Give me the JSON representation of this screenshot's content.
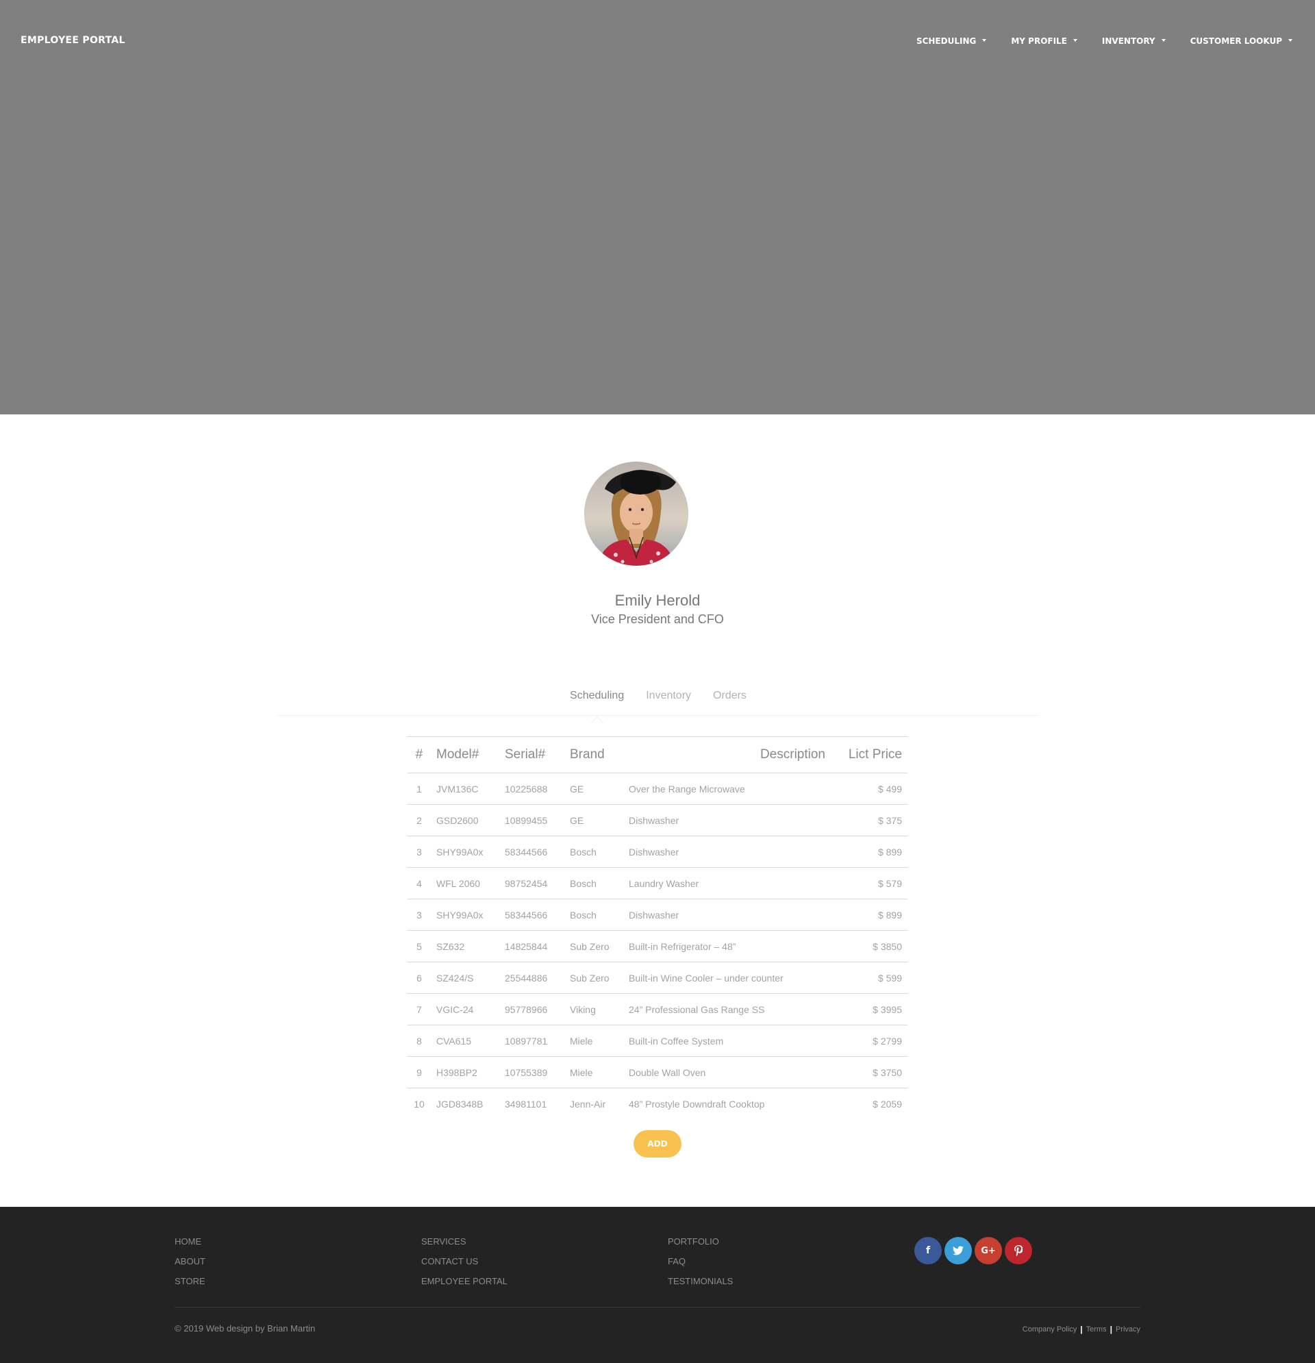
{
  "header": {
    "brand": "EMPLOYEE PORTAL",
    "nav": [
      {
        "label": "SCHEDULING"
      },
      {
        "label": "MY PROFILE"
      },
      {
        "label": "INVENTORY"
      },
      {
        "label": "CUSTOMER LOOKUP"
      }
    ],
    "hero_color": "#808080"
  },
  "profile": {
    "name": "Emily Herold",
    "title": "Vice President and CFO"
  },
  "tabs": [
    {
      "label": "Scheduling",
      "active": true
    },
    {
      "label": "Inventory",
      "active": false
    },
    {
      "label": "Orders",
      "active": false
    }
  ],
  "table": {
    "headers": [
      "#",
      "Model#",
      "Serial#",
      "Brand",
      "Description",
      "Lict Price"
    ],
    "rows": [
      [
        "1",
        "JVM136C",
        "10225688",
        "GE",
        "Over the Range Microwave",
        "$ 499"
      ],
      [
        "2",
        "GSD2600",
        "10899455",
        "GE",
        "Dishwasher",
        "$ 375"
      ],
      [
        "3",
        "SHY99A0x",
        "58344566",
        "Bosch",
        "Dishwasher",
        "$ 899"
      ],
      [
        "4",
        "WFL 2060",
        "98752454",
        "Bosch",
        "Laundry Washer",
        "$ 579"
      ],
      [
        "3",
        "SHY99A0x",
        "58344566",
        "Bosch",
        "Dishwasher",
        "$ 899"
      ],
      [
        "5",
        "SZ632",
        "14825844",
        "Sub Zero",
        "Built-in Refrigerator – 48”",
        "$ 3850"
      ],
      [
        "6",
        "SZ424/S",
        "25544886",
        "Sub Zero",
        "Built-in Wine Cooler – under counter",
        "$ 599"
      ],
      [
        "7",
        "VGIC-24",
        "95778966",
        "Viking",
        "24” Professional Gas Range SS",
        "$ 3995"
      ],
      [
        "8",
        "CVA615",
        "10897781",
        "Miele",
        "Built-in Coffee System",
        "$ 2799"
      ],
      [
        "9",
        "H398BP2",
        "10755389",
        "Miele",
        "Double Wall Oven",
        "$ 3750"
      ],
      [
        "10",
        "JGD8348B",
        "34981101",
        "Jenn-Air",
        "48” Prostyle Downdraft Cooktop",
        "$ 2059"
      ]
    ]
  },
  "add_button": {
    "label": "ADD",
    "color": "#f9c14f"
  },
  "footer": {
    "columns": [
      [
        "HOME",
        "ABOUT",
        "STORE"
      ],
      [
        "SERVICES",
        "CONTACT US",
        "EMPLOYEE PORTAL"
      ],
      [
        "PORTFOLIO",
        "FAQ",
        "TESTIMONIALS"
      ]
    ],
    "socials": [
      {
        "icon": "facebook-icon",
        "glyph": "f",
        "color": "#3b5998"
      },
      {
        "icon": "twitter-icon",
        "glyph": "🐦",
        "color": "#3a9fd9"
      },
      {
        "icon": "google-plus-icon",
        "glyph": "G+",
        "color": "#c7402f"
      },
      {
        "icon": "pinterest-icon",
        "glyph": "P",
        "color": "#c0262d"
      }
    ],
    "copyright": "© 2019 Web design by Brian Martin",
    "legal": [
      "Company Policy",
      "Terms",
      "Privacy"
    ],
    "background": "#232323"
  }
}
